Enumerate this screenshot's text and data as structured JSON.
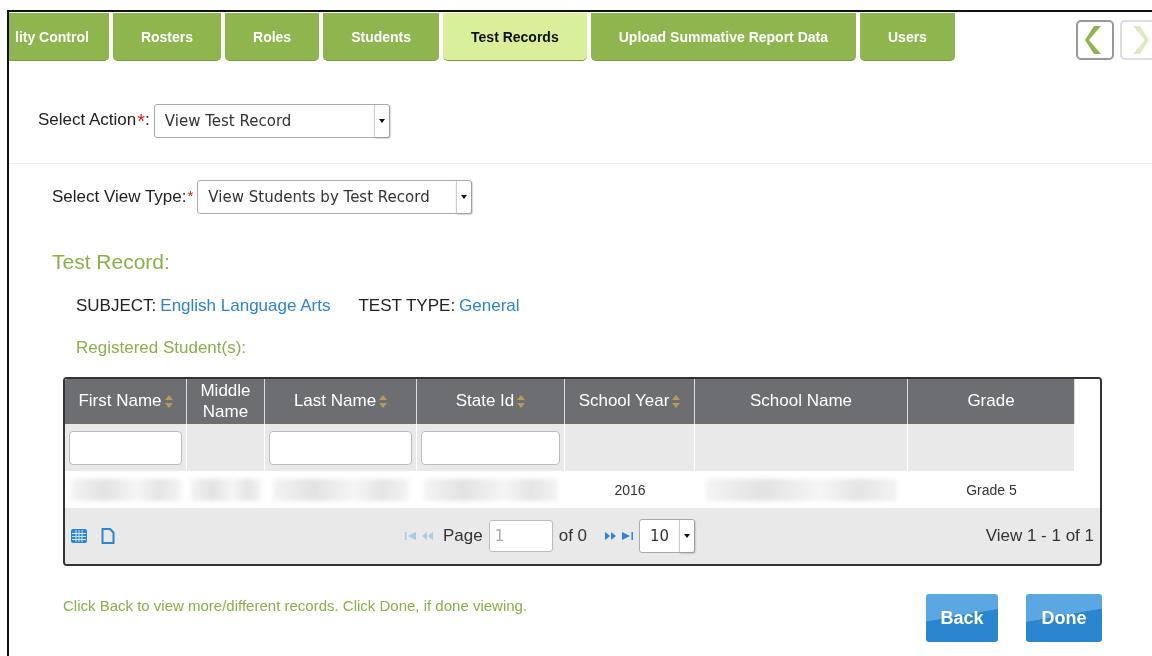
{
  "tabs": [
    {
      "label": "lity Control",
      "selected": false
    },
    {
      "label": "Rosters",
      "selected": false
    },
    {
      "label": "Roles",
      "selected": false
    },
    {
      "label": "Students",
      "selected": false
    },
    {
      "label": "Test Records",
      "selected": true
    },
    {
      "label": "Upload Summative Report Data",
      "selected": false
    },
    {
      "label": "Users",
      "selected": false
    }
  ],
  "nav_arrows": [
    {
      "disabled": false
    },
    {
      "disabled": true
    }
  ],
  "select_action": {
    "label": "Select Action",
    "required_mark": "*",
    "suffix": ":",
    "value": "View Test Record"
  },
  "select_view_type": {
    "label": "Select View Type:",
    "required_mark": "*",
    "value": "View Students by Test Record"
  },
  "test_record": {
    "heading": "Test Record:",
    "fields": [
      {
        "label": "SUBJECT:",
        "value": "English Language Arts"
      },
      {
        "label": "TEST TYPE:",
        "value": "General"
      }
    ]
  },
  "registered_heading": "Registered Student(s):",
  "table": {
    "columns": [
      {
        "label": "First Name",
        "sortable": true,
        "filter": true
      },
      {
        "label": "Middle Name",
        "sortable": false,
        "filter": false
      },
      {
        "label": "Last Name",
        "sortable": true,
        "filter": true
      },
      {
        "label": "State Id",
        "sortable": true,
        "filter": true
      },
      {
        "label": "School Year",
        "sortable": true,
        "filter": false
      },
      {
        "label": "School Name",
        "sortable": false,
        "filter": false
      },
      {
        "label": "Grade",
        "sortable": false,
        "filter": false
      }
    ],
    "rows": [
      [
        {
          "kind": "blurred"
        },
        {
          "kind": "blurred"
        },
        {
          "kind": "blurred"
        },
        {
          "kind": "blurred"
        },
        {
          "kind": "text",
          "text": "2016"
        },
        {
          "kind": "blurred"
        },
        {
          "kind": "text",
          "text": "Grade 5"
        }
      ]
    ],
    "pager": {
      "page_label": "Page",
      "page_value": "1",
      "of_label": "of 0",
      "page_size": "10",
      "summary": "View 1 - 1 of 1"
    }
  },
  "hint": "Click Back to view more/different records. Click Done, if done viewing.",
  "buttons": [
    "Back",
    "Done"
  ]
}
